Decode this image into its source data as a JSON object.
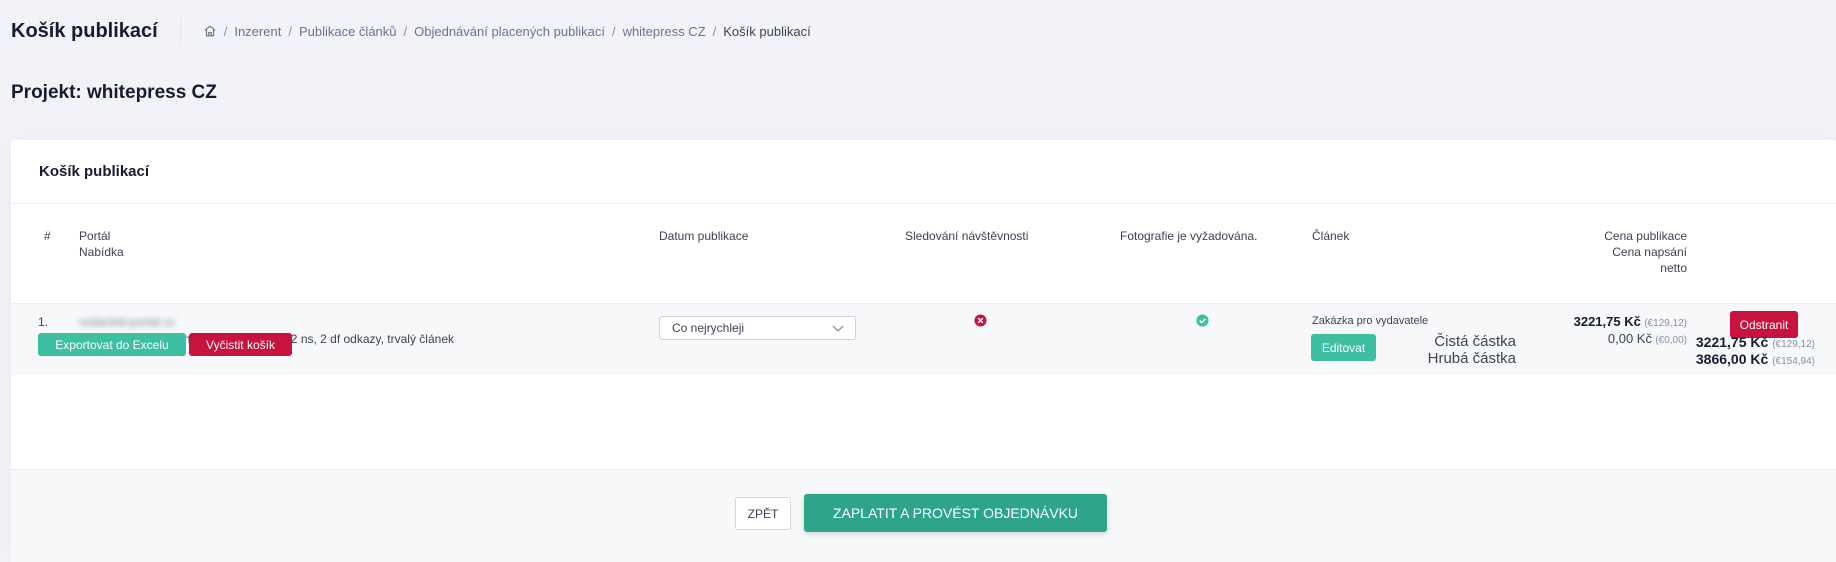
{
  "header": {
    "title": "Košík publikací",
    "breadcrumb": [
      "Inzerent",
      "Publikace článků",
      "Objednávání placených publikací",
      "whitepress CZ",
      "Košík publikací"
    ]
  },
  "project_title": "Projekt: whitepress CZ",
  "card": {
    "title": "Košík publikací",
    "columns": {
      "index": "#",
      "portal": "Portál",
      "offer": "Nabídka",
      "date": "Datum publikace",
      "tracking": "Sledování návštěvnosti",
      "photo": "Fotografie je vyžadována.",
      "article": "Článek",
      "price": "Cena publikace",
      "writing": "Cena napsání",
      "net": "netto"
    },
    "rows": [
      {
        "index": "1.",
        "portal": "redacted-portal.cz",
        "offer": "článek propagován na hp + copywriting 2 ns, 2 df odkazy, trvalý článek",
        "date_value": "Co nejrychleji",
        "tracking": false,
        "photo_required": true,
        "article_type": "Zakázka pro vydavatele",
        "edit_label": "Editovat",
        "price": "3221,75 Kč",
        "price_eur": "(€129,12)",
        "writing_price": "0,00 Kč",
        "writing_price_eur": "(€0,00)",
        "remove_label": "Odstranit"
      }
    ],
    "export_label": "Exportovat do Excelu",
    "clear_label": "Vyčistit košík",
    "totals": {
      "net_label": "Čistá částka",
      "net_value": "3221,75 Kč",
      "net_eur": "(€129,12)",
      "gross_label": "Hrubá částka",
      "gross_value": "3866,00 Kč",
      "gross_eur": "(€154,94)"
    },
    "back_label": "ZPĚT",
    "pay_label": "ZAPLATIT A PROVÉST OBJEDNÁVKU"
  },
  "colors": {
    "teal": "#3fbfa1",
    "red": "#c8133e",
    "pay": "#2ea58a",
    "success": "#3fbfa1",
    "danger": "#c8133e"
  },
  "icons": {
    "home": "home-icon",
    "dropdown": "chevron-down-icon",
    "tracking": "x-circle-icon",
    "photo": "check-circle-icon"
  }
}
